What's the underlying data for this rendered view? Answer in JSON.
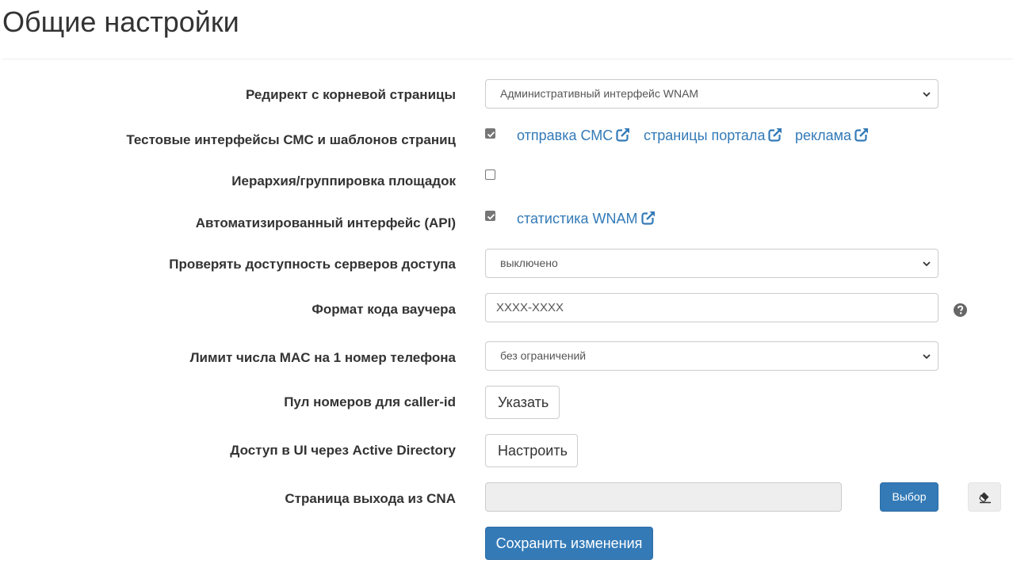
{
  "header": {
    "title": "Общие настройки"
  },
  "form": {
    "redirect": {
      "label": "Редирект с корневой страницы",
      "value": "Административный интерфейс WNAM"
    },
    "test_interfaces": {
      "label": "Тестовые интерфейсы СМС и шаблонов страниц",
      "checked": true,
      "links": [
        "отправка СМС",
        "страницы портала",
        "реклама"
      ]
    },
    "hierarchy": {
      "label": "Иерархия/группировка площадок",
      "checked": false
    },
    "api": {
      "label": "Автоматизированный интерфейс (API)",
      "checked": true,
      "link": "статистика WNAM"
    },
    "check_servers": {
      "label": "Проверять доступность серверов доступа",
      "value": "выключено"
    },
    "voucher_format": {
      "label": "Формат кода ваучера",
      "value": "XXXX-XXXX"
    },
    "mac_limit": {
      "label": "Лимит числа MAC на 1 номер телефона",
      "value": "без ограничений"
    },
    "caller_id_pool": {
      "label": "Пул номеров для caller-id",
      "button": "Указать"
    },
    "active_directory": {
      "label": "Доступ в UI через Active Directory",
      "button": "Настроить"
    },
    "cna_exit": {
      "label": "Страница выхода из CNA",
      "value": "",
      "choose_button": "Выбор"
    },
    "save_button": "Сохранить изменения"
  },
  "icons": {
    "external_link": "external-link-icon",
    "help": "question-circle-icon",
    "eraser": "eraser-icon",
    "chevron": "chevron-down-icon"
  },
  "colors": {
    "link": "#337ab7",
    "primary": "#337ab7",
    "checkbox": "#767676"
  }
}
